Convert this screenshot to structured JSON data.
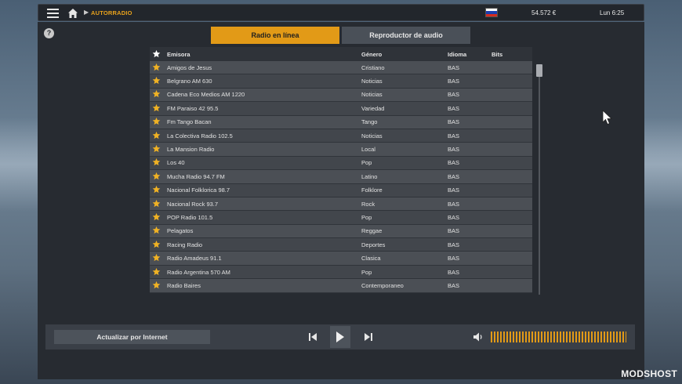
{
  "topbar": {
    "breadcrumb": "AUTORRADIO",
    "money": "54.572 €",
    "clock": "Lun 6:25",
    "flag_colors": [
      "#ffffff",
      "#1c3fb0",
      "#d52b1e"
    ]
  },
  "tabs": {
    "online": "Radio en línea",
    "player": "Reproductor de audio"
  },
  "help_icon": "?",
  "table": {
    "headers": {
      "station": "Emisora",
      "genre": "Género",
      "language": "Idioma",
      "bits": "Bits"
    },
    "rows": [
      {
        "name": "Amigos de Jesus",
        "genre": "Cristiano",
        "lang": "BAS",
        "bits": ""
      },
      {
        "name": "Belgrano AM 630",
        "genre": "Noticias",
        "lang": "BAS",
        "bits": ""
      },
      {
        "name": "Cadena Eco Medios AM 1220",
        "genre": "Noticias",
        "lang": "BAS",
        "bits": ""
      },
      {
        "name": "FM Paraiso 42 95.5",
        "genre": "Variedad",
        "lang": "BAS",
        "bits": ""
      },
      {
        "name": "Fm Tango Bacan",
        "genre": "Tango",
        "lang": "BAS",
        "bits": ""
      },
      {
        "name": "La Colectiva Radio 102.5",
        "genre": "Noticias",
        "lang": "BAS",
        "bits": ""
      },
      {
        "name": "La Mansion Radio",
        "genre": "Local",
        "lang": "BAS",
        "bits": ""
      },
      {
        "name": "Los 40",
        "genre": "Pop",
        "lang": "BAS",
        "bits": ""
      },
      {
        "name": "Mucha Radio 94.7 FM",
        "genre": "Latino",
        "lang": "BAS",
        "bits": ""
      },
      {
        "name": "Nacional Folklorica 98.7",
        "genre": "Folklore",
        "lang": "BAS",
        "bits": ""
      },
      {
        "name": "Nacional Rock 93.7",
        "genre": "Rock",
        "lang": "BAS",
        "bits": ""
      },
      {
        "name": "POP Radio 101.5",
        "genre": "Pop",
        "lang": "BAS",
        "bits": ""
      },
      {
        "name": "Pelagatos",
        "genre": "Reggae",
        "lang": "BAS",
        "bits": ""
      },
      {
        "name": "Racing Radio",
        "genre": "Deportes",
        "lang": "BAS",
        "bits": ""
      },
      {
        "name": "Radio Amadeus 91.1",
        "genre": "Clasica",
        "lang": "BAS",
        "bits": ""
      },
      {
        "name": "Radio Argentina 570 AM",
        "genre": "Pop",
        "lang": "BAS",
        "bits": ""
      },
      {
        "name": "Radio Baires",
        "genre": "Contemporaneo",
        "lang": "BAS",
        "bits": ""
      }
    ]
  },
  "bottombar": {
    "update_label": "Actualizar por Internet",
    "volume_level": 1.0
  },
  "colors": {
    "accent": "#e29a17",
    "star": "#f0b224"
  },
  "watermark": "MODSHOST"
}
